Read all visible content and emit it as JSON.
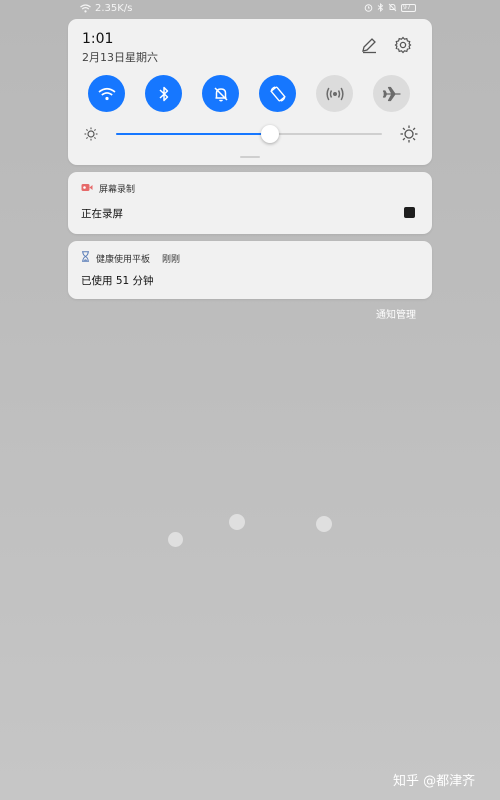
{
  "status_bar": {
    "net_speed": "2.35K/s",
    "battery_level": "97"
  },
  "quick_settings": {
    "time": "1:01",
    "date": "2月13日星期六",
    "toggles": [
      {
        "name": "wifi",
        "state": "on"
      },
      {
        "name": "bluetooth",
        "state": "on"
      },
      {
        "name": "do-not-disturb",
        "state": "on"
      },
      {
        "name": "auto-rotate",
        "state": "on"
      },
      {
        "name": "hotspot",
        "state": "off"
      },
      {
        "name": "airplane-mode",
        "state": "off"
      }
    ],
    "brightness_fraction": 0.58,
    "accent_color": "#1677ff"
  },
  "notifications": [
    {
      "app": "屏幕录制",
      "body": "正在录屏",
      "icon": "video-record-icon",
      "icon_color": "#e66a6a"
    },
    {
      "app": "健康使用平板",
      "time": "刚刚",
      "body": "已使用 51 分钟",
      "icon": "hourglass-icon"
    }
  ],
  "notification_manage_label": "通知管理",
  "watermark": "知乎 @都津齐"
}
